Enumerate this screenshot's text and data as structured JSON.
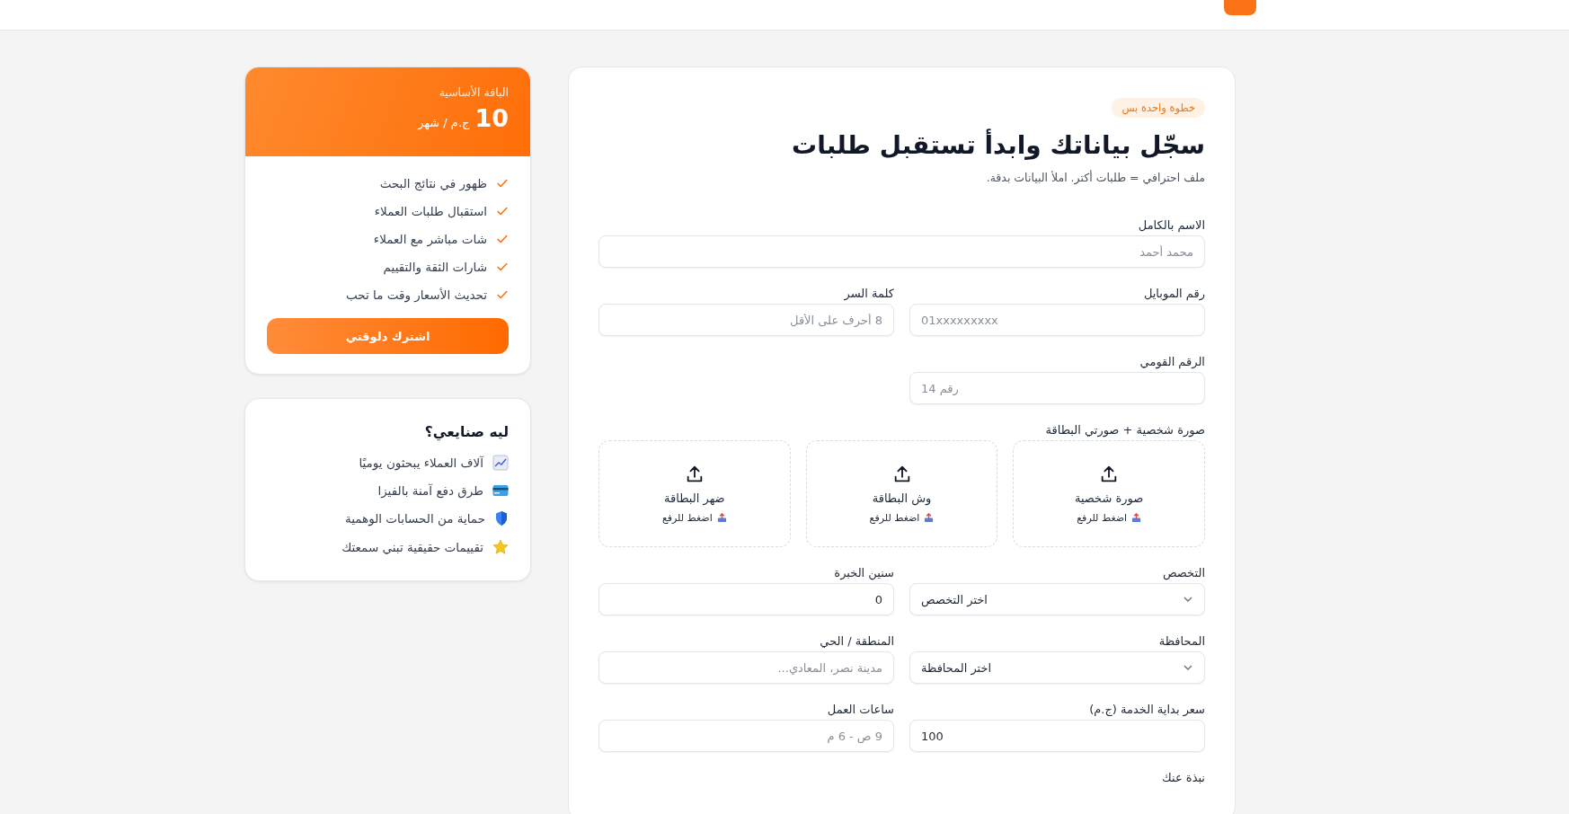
{
  "plan": {
    "name": "الباقة الأساسية",
    "price": "10",
    "period": "ج.م / شهر",
    "features": [
      "ظهور في نتائج البحث",
      "استقبال طلبات العملاء",
      "شات مباشر مع العملاء",
      "شارات الثقة والتقييم",
      "تحديث الأسعار وقت ما تحب"
    ],
    "button": "اشترك دلوقتي"
  },
  "why": {
    "title": "ليه صنايعي؟",
    "items": [
      {
        "kind": "chart",
        "text": "آلاف العملاء يبحثون يوميًا"
      },
      {
        "kind": "card",
        "text": "طرق دفع آمنة بالفيزا"
      },
      {
        "kind": "shield",
        "text": "حماية من الحسابات الوهمية"
      },
      {
        "kind": "star",
        "text": "تقييمات حقيقية تبني سمعتك"
      }
    ]
  },
  "form": {
    "badge": "خطوة واحدة بس",
    "title": "سجّل بياناتك وابدأ تستقبل طلبات",
    "subtitle": "ملف احترافي = طلبات أكتر. املأ البيانات بدقة.",
    "rows": [
      {
        "kind": "full",
        "fields": [
          {
            "kind": "text",
            "label": "الاسم بالكامل",
            "placeholder": "محمد أحمد"
          }
        ]
      },
      {
        "kind": "pair",
        "fields": [
          {
            "kind": "text",
            "label": "رقم الموبايل",
            "placeholder": "01xxxxxxxxx",
            "ltr": true
          },
          {
            "kind": "text",
            "label": "كلمة السر",
            "placeholder": "8 أحرف على الأقل"
          }
        ]
      },
      {
        "kind": "half",
        "fields": [
          {
            "kind": "text",
            "label": "الرقم القومي",
            "placeholder": "رقم 14",
            "ltr": true
          }
        ]
      },
      {
        "kind": "uploads",
        "label": "صورة شخصية + صورتي البطاقة",
        "items": [
          {
            "title": "صورة شخصية",
            "hint": "اضغط للرفع"
          },
          {
            "title": "وش البطاقة",
            "hint": "اضغط للرفع"
          },
          {
            "title": "ضهر البطاقة",
            "hint": "اضغط للرفع"
          }
        ]
      },
      {
        "kind": "pair",
        "fields": [
          {
            "kind": "select",
            "label": "التخصص",
            "value": "اختر التخصص"
          },
          {
            "kind": "text",
            "label": "سنين الخبرة",
            "value": "0"
          }
        ]
      },
      {
        "kind": "pair",
        "fields": [
          {
            "kind": "select",
            "label": "المحافظة",
            "value": "اختر المحافظة"
          },
          {
            "kind": "text",
            "label": "المنطقة / الحي",
            "placeholder": "مدينة نصر، المعادي..."
          }
        ]
      },
      {
        "kind": "pair",
        "fields": [
          {
            "kind": "text",
            "label": "سعر بداية الخدمة (ج.م)",
            "value": "100",
            "ltr": true
          },
          {
            "kind": "text",
            "label": "ساعات العمل",
            "placeholder": "9 ص - 6 م"
          }
        ]
      },
      {
        "kind": "label",
        "label": "نبذة عنك"
      }
    ]
  }
}
